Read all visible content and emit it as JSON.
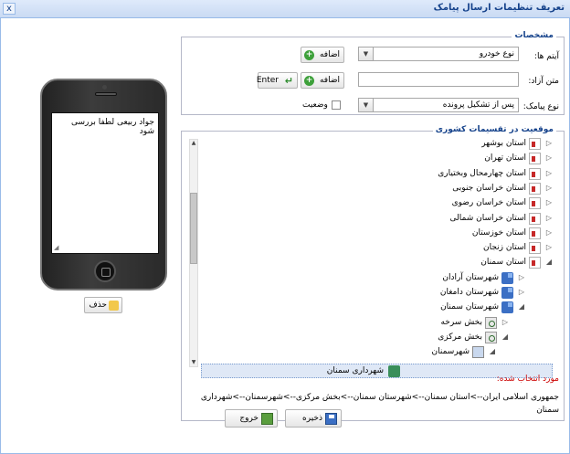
{
  "window": {
    "title": "تعریف تنظیمات ارسال پیامک",
    "close_symbol": "x"
  },
  "specs": {
    "legend": "مشخصات",
    "item_label": "آیتم ها:",
    "item_value": "نوع خودرو",
    "add_label": "اضافه",
    "free_text_label": "متن آزاد:",
    "free_text_value": "",
    "add2_label": "اضافه",
    "enter_label": "Enter",
    "sms_type_label": "نوع پیامک:",
    "sms_type_value": "پس از تشکیل پرونده",
    "status_label": "وضعیت"
  },
  "phone": {
    "sms_text": "جواد ربیعی لطفا بررسی شود",
    "delete_label": "حذف"
  },
  "location": {
    "legend": "موقعیت در تقسیمات کشوری",
    "items": [
      {
        "label": "استان بوشهر",
        "icon": "folder-red-icon",
        "toggle": "▷"
      },
      {
        "label": "استان تهران",
        "icon": "folder-red-icon",
        "toggle": "▷"
      },
      {
        "label": "استان چهارمحال وبختیاری",
        "icon": "folder-red-icon",
        "toggle": "▷"
      },
      {
        "label": "استان خراسان جنوبی",
        "icon": "folder-red-icon",
        "toggle": "▷"
      },
      {
        "label": "استان خراسان رضوی",
        "icon": "folder-red-icon",
        "toggle": "▷"
      },
      {
        "label": "استان خراسان شمالی",
        "icon": "folder-red-icon",
        "toggle": "▷"
      },
      {
        "label": "استان خوزستان",
        "icon": "folder-red-icon",
        "toggle": "▷"
      },
      {
        "label": "استان زنجان",
        "icon": "folder-red-icon",
        "toggle": "▷"
      },
      {
        "label": "استان سمنان",
        "icon": "folder-red-icon",
        "toggle": "◢"
      },
      {
        "label": "شهرستان آرادان",
        "icon": "blue-icon",
        "toggle": "▷"
      },
      {
        "label": "شهرستان دامغان",
        "icon": "blue-icon",
        "toggle": "▷"
      },
      {
        "label": "شهرستان سمنان",
        "icon": "blue-icon",
        "toggle": "◢"
      },
      {
        "label": "بخش سرخه",
        "icon": "search-icon",
        "toggle": "▷"
      },
      {
        "label": "بخش مرکزی",
        "icon": "search-icon",
        "toggle": "◢"
      },
      {
        "label": "شهرسمنان",
        "icon": "photo-icon",
        "toggle": "◢"
      },
      {
        "label": "شهرداری سمنان",
        "icon": "green-icon",
        "toggle": ""
      }
    ],
    "selected_title": "مورد انتخاب شده:",
    "selected_path": "جمهوری اسلامی ایران-->استان سمنان-->شهرستان سمنان-->بخش مرکزی-->شهرسمنان-->شهرداری سمنان"
  },
  "footer": {
    "save_label": "ذخیره",
    "exit_label": "خروج"
  }
}
